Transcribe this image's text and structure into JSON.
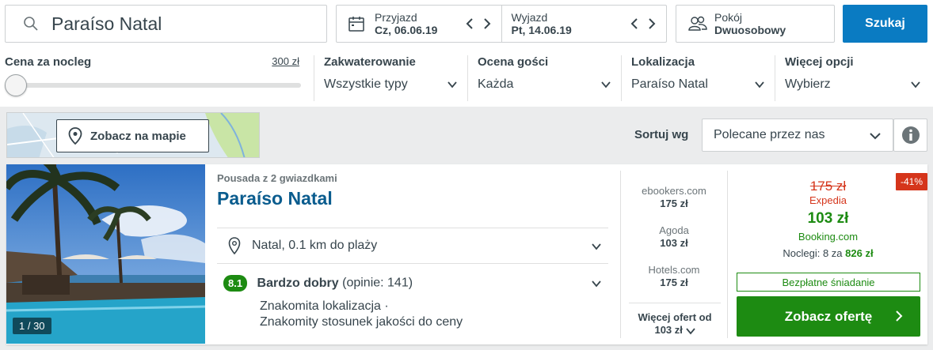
{
  "search": {
    "destination": "Paraíso Natal"
  },
  "dates": {
    "checkin_label": "Przyjazd",
    "checkin_value": "Cz, 06.06.19",
    "checkout_label": "Wyjazd",
    "checkout_value": "Pt, 14.06.19"
  },
  "room": {
    "label": "Pokój",
    "value": "Dwuosobowy"
  },
  "search_button": "Szukaj",
  "filters": {
    "price_label": "Cena za nocleg",
    "price_max": "300 zł",
    "price_level": 0,
    "items": [
      {
        "label": "Zakwaterowanie",
        "value": "Wszystkie typy"
      },
      {
        "label": "Ocena gości",
        "value": "Każda"
      },
      {
        "label": "Lokalizacja",
        "value": "Paraíso Natal"
      },
      {
        "label": "Więcej opcji",
        "value": "Wybierz"
      }
    ]
  },
  "map_button": "Zobacz na mapie",
  "sort": {
    "label": "Sortuj wg",
    "value": "Polecane przez nas"
  },
  "hotel": {
    "photo_count": "1 / 30",
    "type": "Pousada z 2 gwiazdkami",
    "name": "Paraíso Natal",
    "location": "Natal, 0.1 km do plaży",
    "rating_score": "8.1",
    "rating_label": "Bardzo dobry",
    "rating_count": "(opinie: 141)",
    "highlight_1": "Znakomita lokalizacja ·",
    "highlight_2": "Znakomity stosunek jakości do ceny"
  },
  "other_offers": [
    {
      "site": "ebookers.com",
      "price": "175 zł"
    },
    {
      "site": "Agoda",
      "price": "103 zł"
    },
    {
      "site": "Hotels.com",
      "price": "175 zł"
    }
  ],
  "more_offers": {
    "label": "Więcej ofert od",
    "price": "103 zł"
  },
  "deal": {
    "discount": "-41%",
    "old_price": "175 zł",
    "old_site": "Expedia",
    "new_price": "103 zł",
    "new_site": "Booking.com",
    "nights_label": "Noclegi: 8 za",
    "nights_total": "826 zł",
    "breakfast": "Bezpłatne śniadanie",
    "button": "Zobacz ofertę"
  },
  "colors": {
    "primary_blue": "#0a7bc2",
    "title_blue": "#0a5c8e",
    "green": "#1d8b12",
    "red": "#d5351b",
    "text": "#37454d"
  }
}
